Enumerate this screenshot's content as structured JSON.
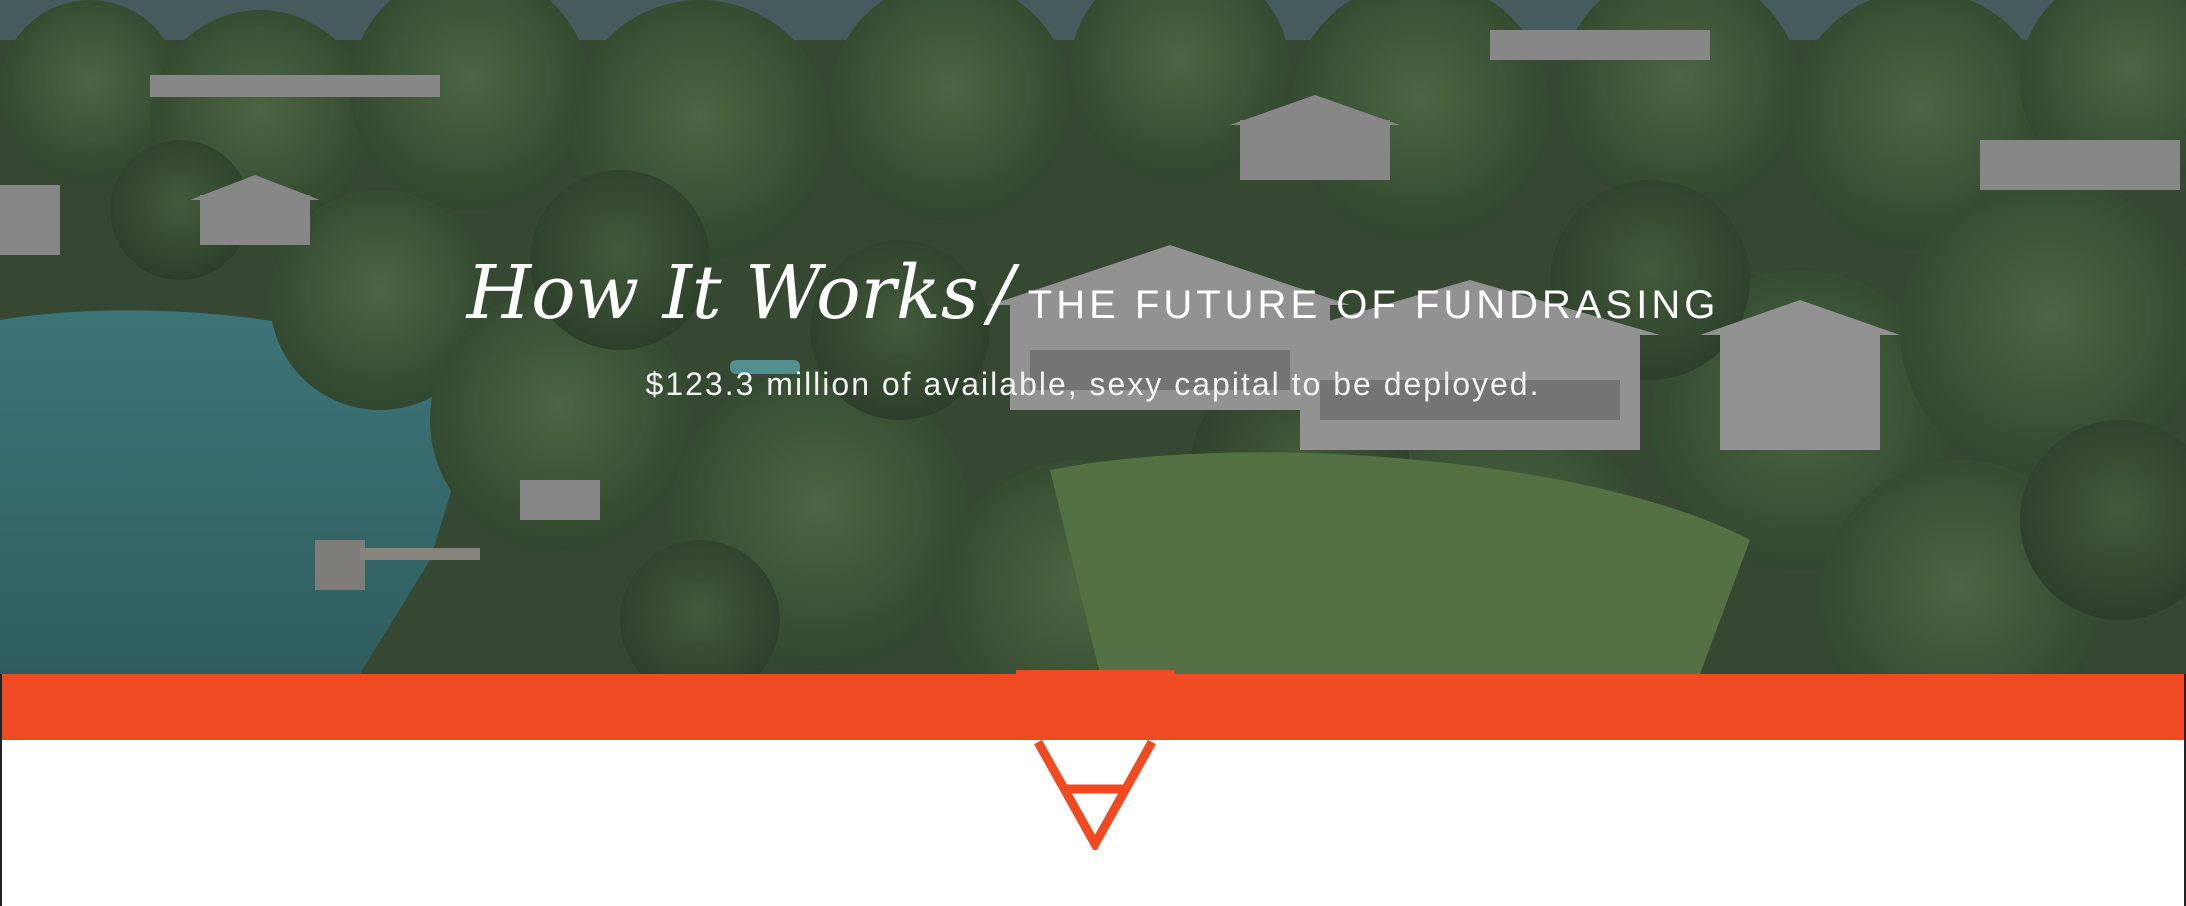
{
  "hero": {
    "title_script": "How It Works",
    "title_separator": "/",
    "title_caps": "THE FUTURE OF FUNDRASING",
    "subtitle": "$123.3 million of available, sexy capital to be deployed."
  },
  "colors": {
    "accent": "#f04a22",
    "hero_overlay": "#373737",
    "text_on_hero": "#ffffff",
    "background": "#ffffff"
  },
  "icons": {
    "brand_mark": "triangle-logo-icon"
  }
}
